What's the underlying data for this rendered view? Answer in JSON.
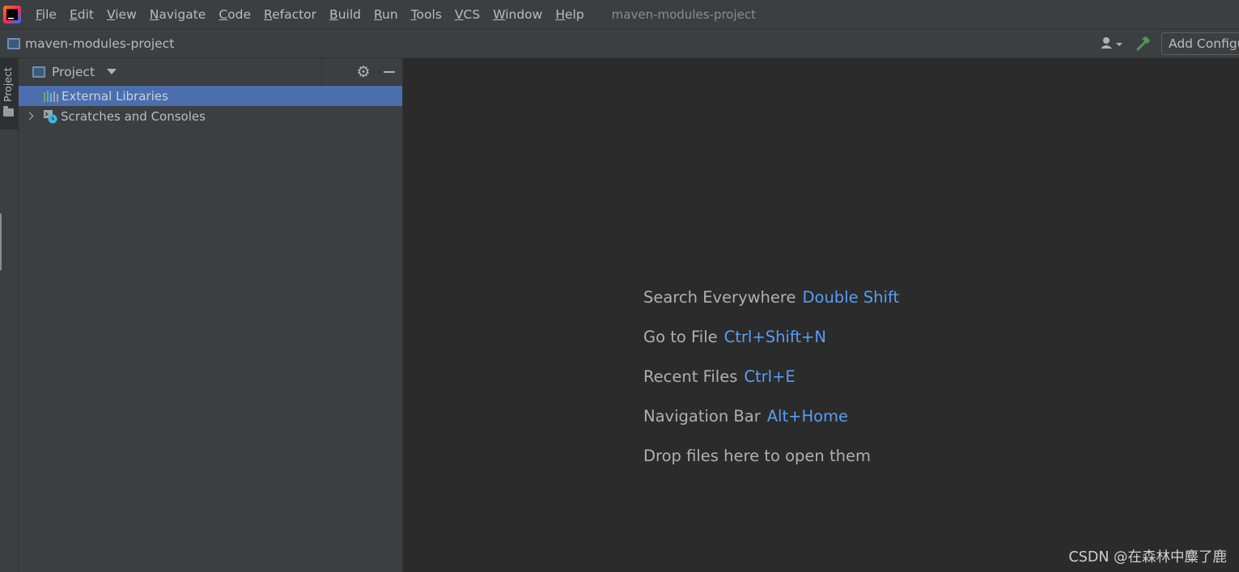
{
  "menubar": {
    "logo_text": "IJ",
    "items": [
      {
        "mnemonic": "F",
        "rest": "ile"
      },
      {
        "mnemonic": "E",
        "rest": "dit"
      },
      {
        "mnemonic": "V",
        "rest": "iew"
      },
      {
        "mnemonic": "N",
        "rest": "avigate"
      },
      {
        "mnemonic": "C",
        "rest": "ode"
      },
      {
        "mnemonic": "R",
        "rest": "efactor"
      },
      {
        "mnemonic": "B",
        "rest": "uild"
      },
      {
        "mnemonic": "R",
        "rest": "un"
      },
      {
        "mnemonic": "T",
        "rest": "ools"
      },
      {
        "mnemonic": "V",
        "rest": "CS"
      },
      {
        "mnemonic": "W",
        "rest": "indow"
      },
      {
        "mnemonic": "H",
        "rest": "elp"
      }
    ],
    "window_title": "maven-modules-project"
  },
  "navbar": {
    "breadcrumb": "maven-modules-project",
    "add_config_label": "Add Configuration...",
    "icons": [
      "user-icon",
      "hammer-icon"
    ]
  },
  "tool_stripe": {
    "project_label": "Project"
  },
  "project_panel": {
    "title": "Project",
    "tree": [
      {
        "label": "External Libraries",
        "selected": true,
        "icon": "library-icon"
      },
      {
        "label": "Scratches and Consoles",
        "selected": false,
        "icon": "scratches-icon"
      }
    ]
  },
  "editor": {
    "hints": [
      {
        "label": "Search Everywhere",
        "shortcut": "Double Shift"
      },
      {
        "label": "Go to File",
        "shortcut": "Ctrl+Shift+N"
      },
      {
        "label": "Recent Files",
        "shortcut": "Ctrl+E"
      },
      {
        "label": "Navigation Bar",
        "shortcut": "Alt+Home"
      },
      {
        "label": "Drop files here to open them",
        "shortcut": ""
      }
    ],
    "watermark": "CSDN @在森林中麋了鹿"
  },
  "colors": {
    "background": "#2b2b2b",
    "panel": "#3c3f41",
    "selection": "#4b6eaf",
    "shortcut": "#589df6",
    "build_green": "#499c54"
  }
}
